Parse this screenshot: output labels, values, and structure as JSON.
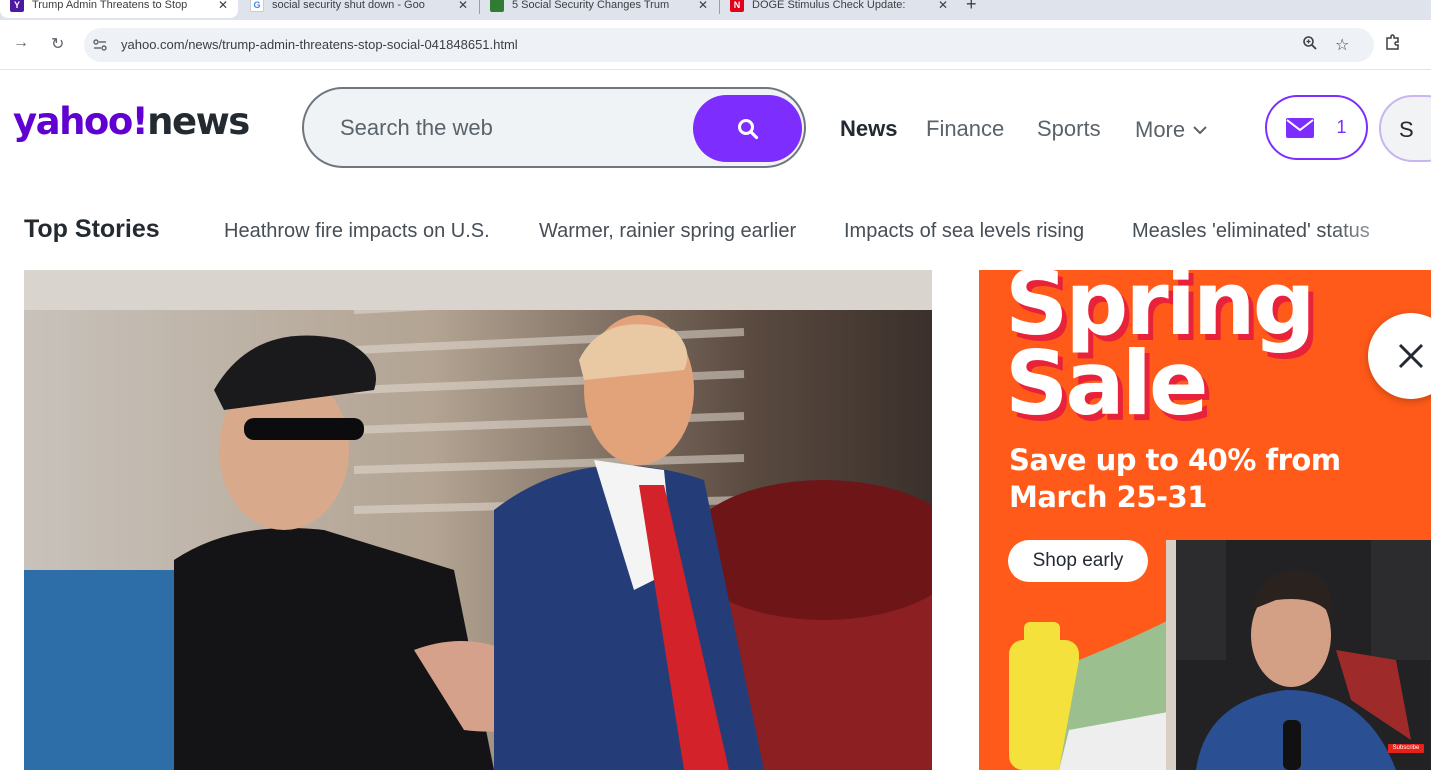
{
  "browser": {
    "tabs": [
      {
        "title": "Trump Admin Threatens to Stop",
        "favicon": "yahoo-favicon",
        "favicon_color": "#4b1aa1",
        "active": true
      },
      {
        "title": "social security shut down - Goo",
        "favicon": "google-favicon",
        "favicon_color": "#4285f4",
        "active": false
      },
      {
        "title": "5 Social Security Changes Trum",
        "favicon": "site-favicon",
        "favicon_color": "#2e7d32",
        "active": false
      },
      {
        "title": "DOGE Stimulus Check Update: ",
        "favicon": "newsweek-favicon",
        "favicon_color": "#e2001a",
        "active": false
      }
    ],
    "url": "yahoo.com/news/trump-admin-threatens-stop-social-041848651.html"
  },
  "header": {
    "logo_yahoo": "yahoo!",
    "logo_news": "news",
    "search_placeholder": "Search the web",
    "nav": [
      "News",
      "Finance",
      "Sports"
    ],
    "more_label": "More",
    "mail_count": "1",
    "avatar_initial": "S"
  },
  "top_stories": {
    "title": "Top Stories",
    "items": [
      "Heathrow fire impacts on U.S.",
      "Warmer, rainier spring earlier",
      "Impacts of sea levels rising",
      "Measles 'eliminated' status"
    ]
  },
  "ad": {
    "headline_1": "Spring",
    "headline_2": "Sale",
    "subhead_1": "Save up to 40% from",
    "subhead_2": "March 25-31",
    "cta": "Shop early"
  },
  "webcam": {
    "badge": "Subscribe"
  },
  "colors": {
    "yahoo_purple": "#6001d2",
    "accent_purple": "#7d2eff",
    "ad_orange": "#ff5a19",
    "ad_red": "#e8223a"
  }
}
